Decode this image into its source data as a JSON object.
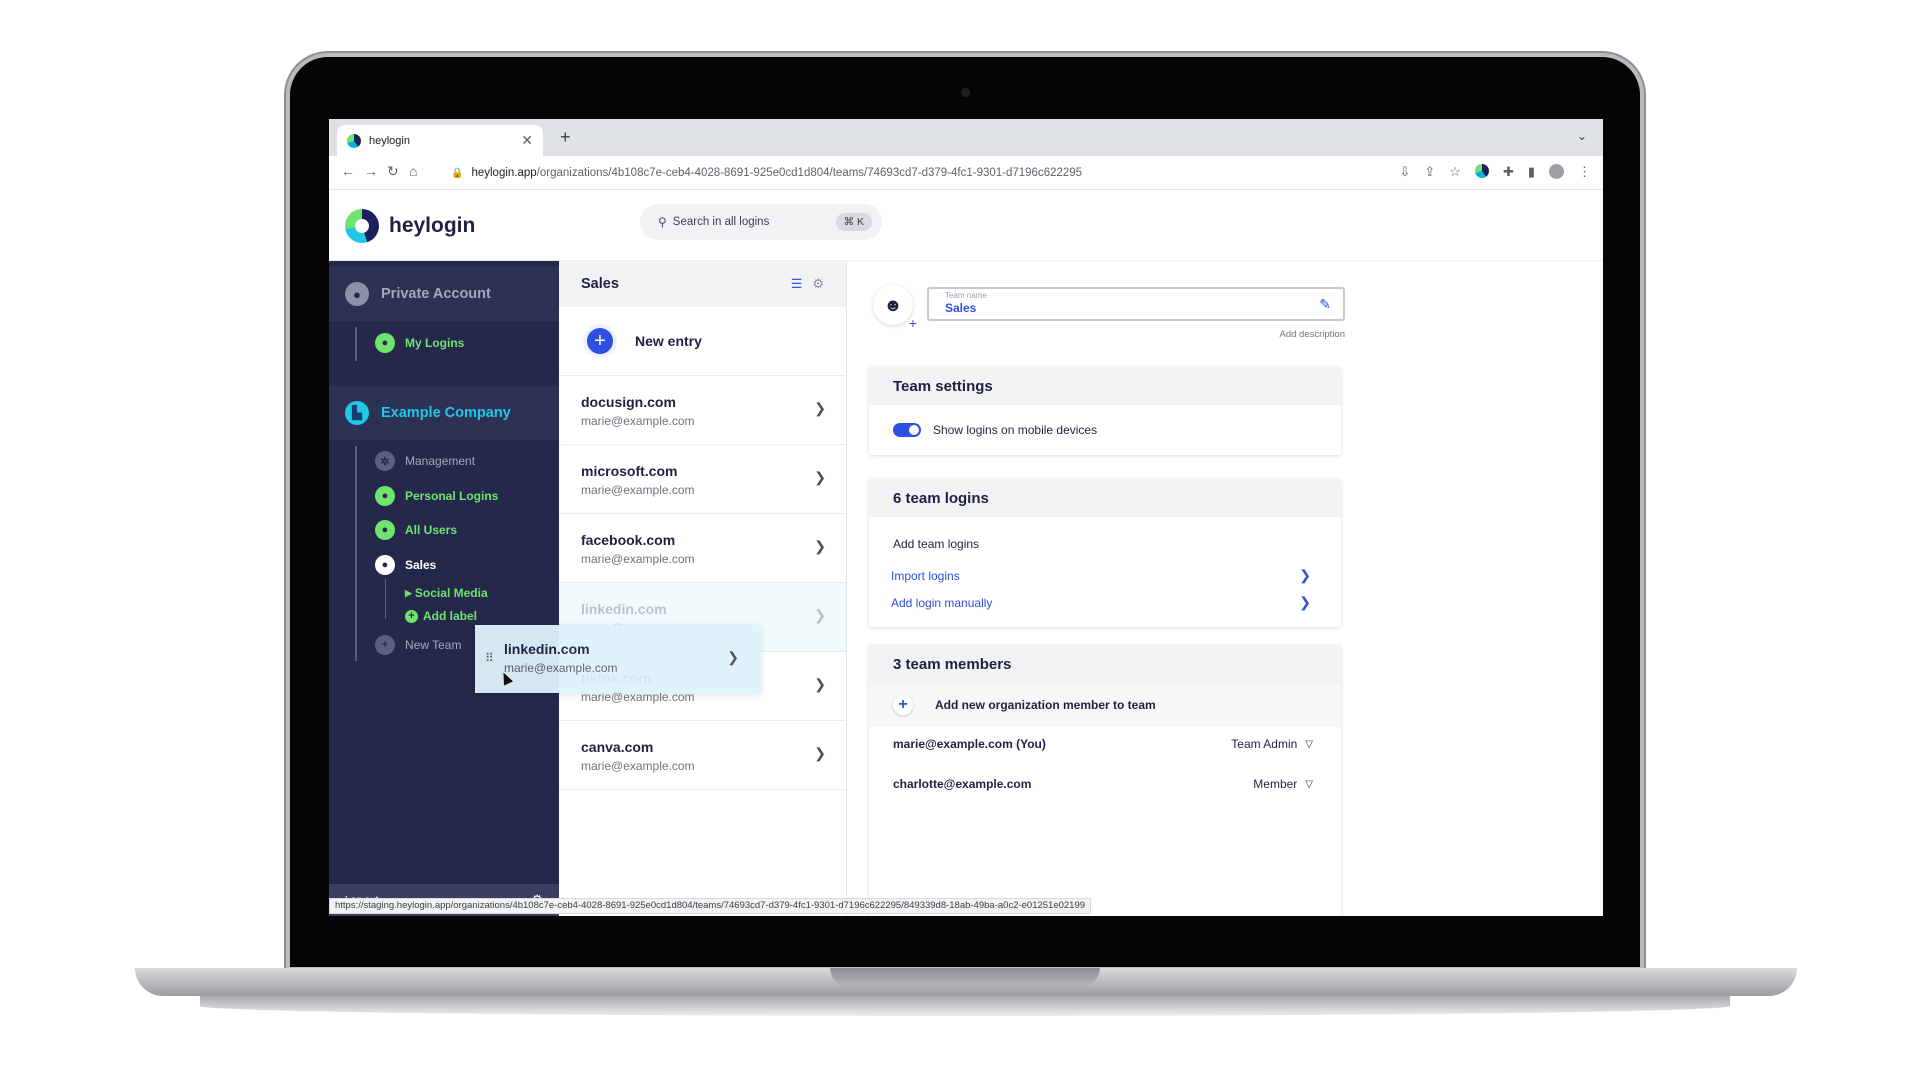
{
  "browser": {
    "tab_title": "heylogin",
    "tab_close": "✕",
    "new_tab": "+",
    "address_host": "heylogin.app",
    "address_path": "/organizations/4b108c7e-ceb4-4028-8691-925e0cd1d804/teams/74693cd7-d379-4fc1-9301-d7196c622295",
    "status_url": "https://staging.heylogin.app/organizations/4b108c7e-ceb4-4028-8691-925e0cd1d804/teams/74693cd7-d379-4fc1-9301-d7196c622295/849339d8-18ab-49ba-a0c2-e01251e02199"
  },
  "header": {
    "logo_text": "heylogin",
    "search_placeholder": "Search in all logins",
    "search_shortcut": "⌘ K"
  },
  "sidebar": {
    "private_account": "Private Account",
    "my_logins": "My Logins",
    "company": "Example Company",
    "items": [
      {
        "label": "Management"
      },
      {
        "label": "Personal Logins"
      },
      {
        "label": "All Users"
      },
      {
        "label": "Sales"
      }
    ],
    "sub_items": [
      {
        "label": "Social Media"
      },
      {
        "label": "Add label"
      }
    ],
    "new_team": "New Team",
    "logout": "Log out"
  },
  "list": {
    "title": "Sales",
    "new_entry": "New entry",
    "entries": [
      {
        "domain": "docusign.com",
        "email": "marie@example.com"
      },
      {
        "domain": "microsoft.com",
        "email": "marie@example.com"
      },
      {
        "domain": "facebook.com",
        "email": "marie@example.com"
      },
      {
        "domain": "linkedin.com",
        "email": "marie@example.com"
      },
      {
        "domain": "tiktok.com",
        "email": "marie@example.com"
      },
      {
        "domain": "canva.com",
        "email": "marie@example.com"
      }
    ],
    "drag_card": {
      "domain": "linkedin.com",
      "email": "marie@example.com"
    }
  },
  "detail": {
    "name_label": "Team name",
    "name_value": "Sales",
    "add_description": "Add description",
    "settings_title": "Team settings",
    "toggle_label": "Show logins on mobile devices",
    "logins_title": "6 team logins",
    "add_team_logins": "Add team logins",
    "import_logins": "Import logins",
    "add_manually": "Add login manually",
    "members_title": "3 team members",
    "add_member": "Add new organization member to team",
    "members": [
      {
        "email": "marie@example.com (You)",
        "role": "Team Admin"
      },
      {
        "email": "charlotte@example.com",
        "role": "Member"
      }
    ]
  },
  "colors": {
    "accent_blue": "#2f4fe0",
    "sidebar_bg": "#25284a",
    "green": "#6ee36e",
    "cyan": "#1ec8e6"
  }
}
